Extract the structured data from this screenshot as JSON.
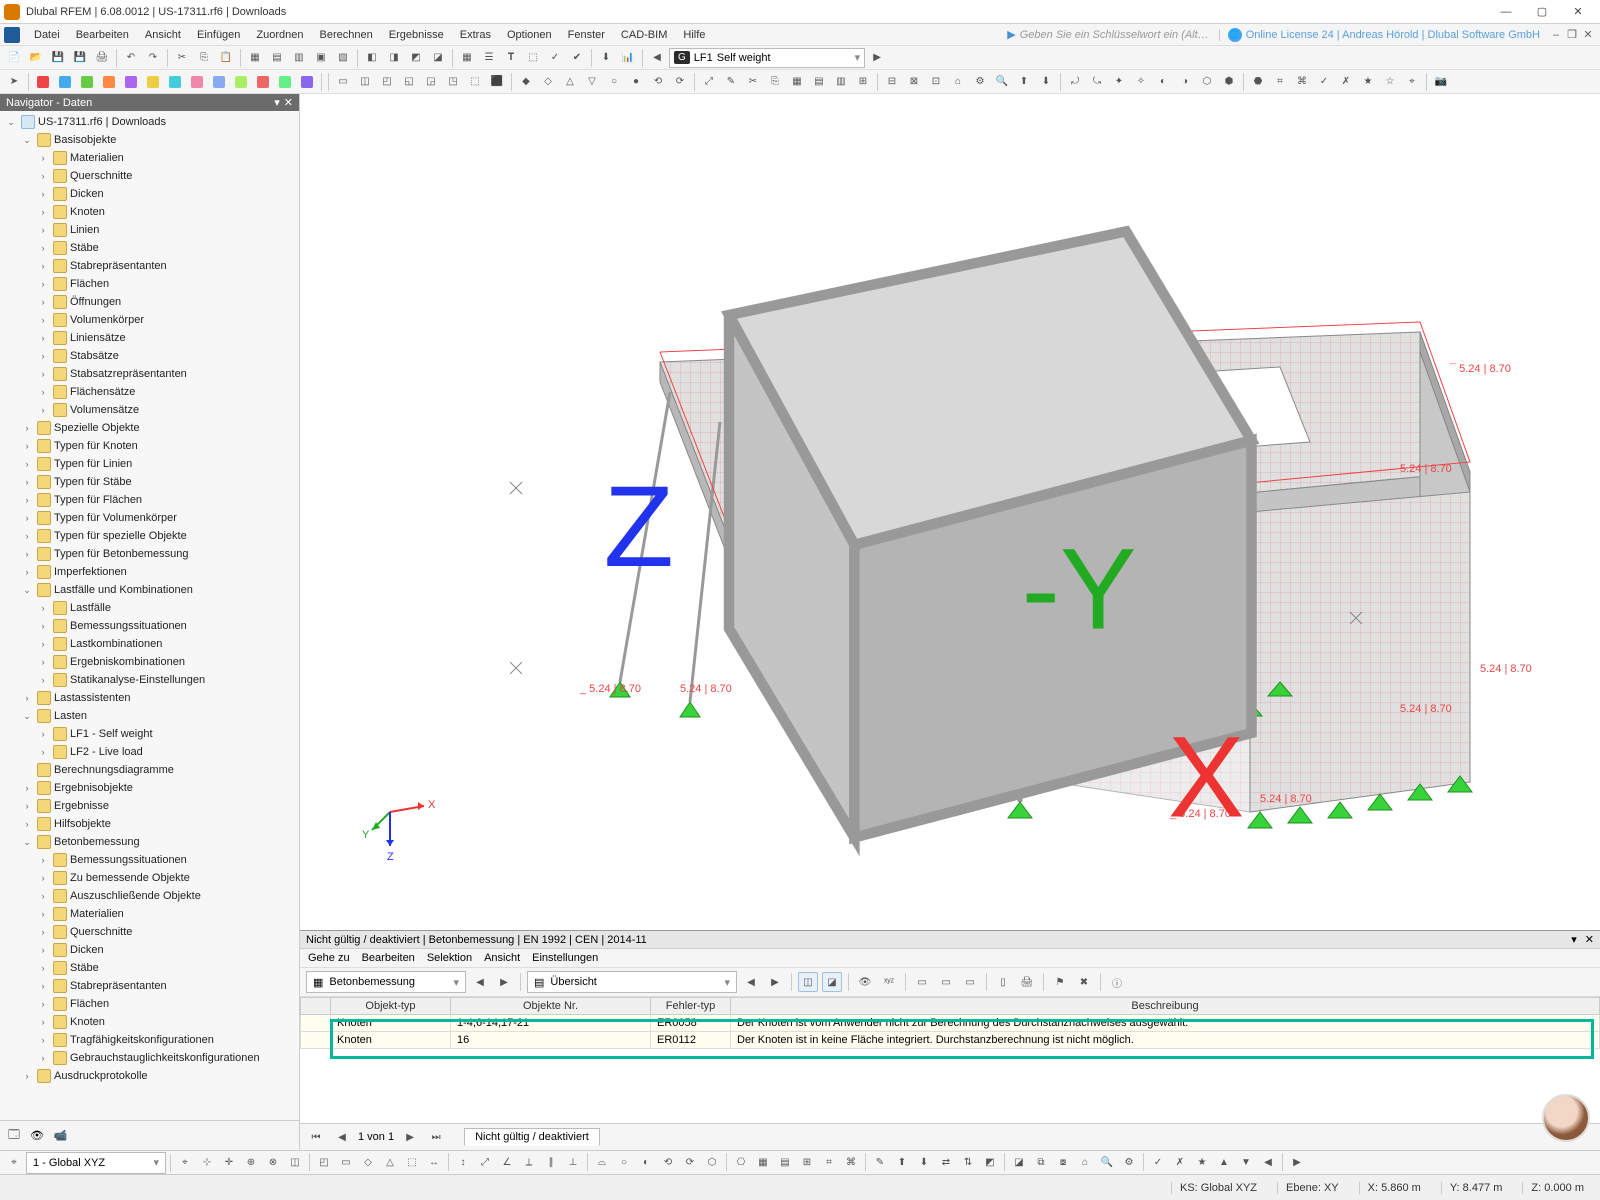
{
  "title": "Dlubal RFEM | 6.08.0012 | US-17311.rf6 | Downloads",
  "menu": [
    "Datei",
    "Bearbeiten",
    "Ansicht",
    "Einfügen",
    "Zuordnen",
    "Berechnen",
    "Ergebnisse",
    "Extras",
    "Optionen",
    "Fenster",
    "CAD-BIM",
    "Hilfe"
  ],
  "search_hint": "Geben Sie ein Schlüsselwort ein (Alt…",
  "license": "Online License 24 | Andreas Hörold | Dlubal Software GmbH",
  "toolbar1": {
    "lf_badge_prefix": "G",
    "lf_code": "LF1",
    "lf_name": "Self weight"
  },
  "navigator": {
    "title": "Navigator - Daten",
    "root": "US-17311.rf6 | Downloads",
    "groups": [
      {
        "label": "Basisobjekte",
        "indent": 1,
        "expanded": true,
        "children": [
          {
            "label": "Materialien"
          },
          {
            "label": "Querschnitte"
          },
          {
            "label": "Dicken"
          },
          {
            "label": "Knoten"
          },
          {
            "label": "Linien"
          },
          {
            "label": "Stäbe"
          },
          {
            "label": "Stabrepräsentanten"
          },
          {
            "label": "Flächen"
          },
          {
            "label": "Öffnungen"
          },
          {
            "label": "Volumenkörper"
          },
          {
            "label": "Liniensätze"
          },
          {
            "label": "Stabsätze"
          },
          {
            "label": "Stabsatzrepräsentanten"
          },
          {
            "label": "Flächensätze"
          },
          {
            "label": "Volumensätze"
          }
        ]
      },
      {
        "label": "Spezielle Objekte",
        "indent": 1
      },
      {
        "label": "Typen für Knoten",
        "indent": 1
      },
      {
        "label": "Typen für Linien",
        "indent": 1
      },
      {
        "label": "Typen für Stäbe",
        "indent": 1
      },
      {
        "label": "Typen für Flächen",
        "indent": 1
      },
      {
        "label": "Typen für Volumenkörper",
        "indent": 1
      },
      {
        "label": "Typen für spezielle Objekte",
        "indent": 1
      },
      {
        "label": "Typen für Betonbemessung",
        "indent": 1
      },
      {
        "label": "Imperfektionen",
        "indent": 1
      },
      {
        "label": "Lastfälle und Kombinationen",
        "indent": 1,
        "expanded": true,
        "children": [
          {
            "label": "Lastfälle"
          },
          {
            "label": "Bemessungssituationen"
          },
          {
            "label": "Lastkombinationen"
          },
          {
            "label": "Ergebniskombinationen"
          },
          {
            "label": "Statikanalyse-Einstellungen"
          }
        ]
      },
      {
        "label": "Lastassistenten",
        "indent": 1
      },
      {
        "label": "Lasten",
        "indent": 1,
        "expanded": true,
        "children": [
          {
            "label": "LF1 - Self weight"
          },
          {
            "label": "LF2 - Live load"
          }
        ]
      },
      {
        "label": "Berechnungsdiagramme",
        "indent": 1,
        "leaf": true
      },
      {
        "label": "Ergebnisobjekte",
        "indent": 1
      },
      {
        "label": "Ergebnisse",
        "indent": 1
      },
      {
        "label": "Hilfsobjekte",
        "indent": 1
      },
      {
        "label": "Betonbemessung",
        "indent": 1,
        "expanded": true,
        "children": [
          {
            "label": "Bemessungssituationen"
          },
          {
            "label": "Zu bemessende Objekte"
          },
          {
            "label": "Auszuschließende Objekte"
          },
          {
            "label": "Materialien"
          },
          {
            "label": "Querschnitte"
          },
          {
            "label": "Dicken"
          },
          {
            "label": "Stäbe"
          },
          {
            "label": "Stabrepräsentanten"
          },
          {
            "label": "Flächen"
          },
          {
            "label": "Knoten"
          },
          {
            "label": "Tragfähigkeitskonfigurationen"
          },
          {
            "label": "Gebrauchstauglichkeitskonfigurationen"
          }
        ]
      },
      {
        "label": "Ausdruckprotokolle",
        "indent": 1
      }
    ]
  },
  "viewport": {
    "annotations": [
      "5.24 | 8.70",
      "5.24 | 8.70",
      "5.24 | 8.70",
      "5.24 | 8.70",
      "5.24 | 8.70",
      "5.24 | 8.70",
      "5.24 | 8.70",
      "5.24 | 8.70"
    ],
    "axes": {
      "x": "X",
      "y": "Y",
      "z": "Z"
    },
    "cube_faces": {
      "x": "X",
      "y": "-Y",
      "z": "Z"
    }
  },
  "bottom_panel": {
    "title": "Nicht gültig / deaktiviert | Betonbemessung | EN 1992 | CEN | 2014-11",
    "menu": [
      "Gehe zu",
      "Bearbeiten",
      "Selektion",
      "Ansicht",
      "Einstellungen"
    ],
    "combo1": "Betonbemessung",
    "combo2": "Übersicht",
    "headers": [
      "Objekt-typ",
      "Objekte Nr.",
      "Fehler-typ",
      "Beschreibung"
    ],
    "rows": [
      {
        "typ": "Knoten",
        "nr": "1-4,6-14,17-21",
        "err": "ER0058",
        "desc": "Der Knoten ist vom Anwender nicht zur Berechnung des Durchstanznachweises ausgewählt."
      },
      {
        "typ": "Knoten",
        "nr": "16",
        "err": "ER0112",
        "desc": "Der Knoten ist in keine Fläche integriert. Durchstanzberechnung ist nicht möglich."
      }
    ],
    "pager": {
      "text": "1 von 1",
      "tab": "Nicht gültig / deaktiviert"
    }
  },
  "bottombar": {
    "cs_label": "1 - Global XYZ"
  },
  "status": {
    "ks": "KS: Global XYZ",
    "ebene": "Ebene: XY",
    "x": "X: 5.860 m",
    "y": "Y: 8.477 m",
    "z": "Z: 0.000 m"
  }
}
